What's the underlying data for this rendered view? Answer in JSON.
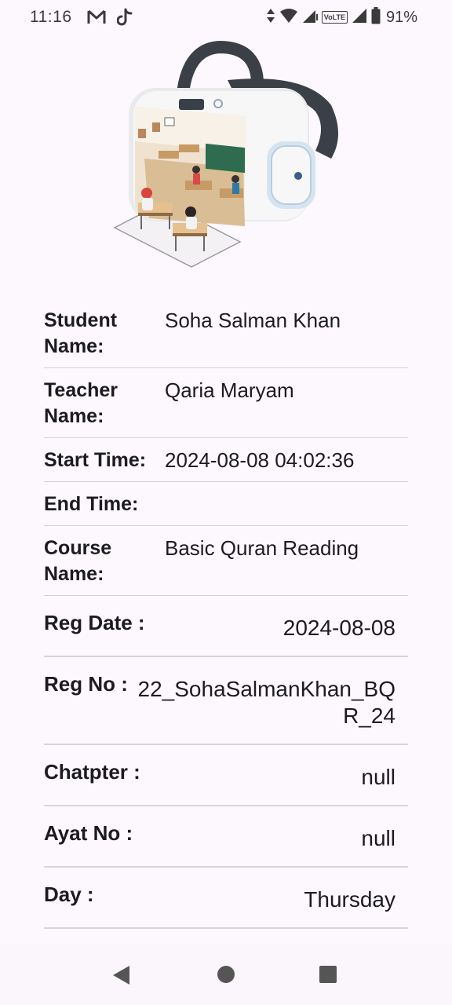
{
  "status_bar": {
    "time": "11:16",
    "battery_percent": "91%",
    "volte": "VoLTE"
  },
  "hero": {
    "icon": "vr-headset-classroom-illustration"
  },
  "details_a": [
    {
      "label": "Student Name:",
      "value": "Soha Salman Khan"
    },
    {
      "label": "Teacher Name:",
      "value": "Qaria Maryam"
    },
    {
      "label": "Start Time:",
      "value": "2024-08-08 04:02:36"
    },
    {
      "label": "End Time:",
      "value": ""
    },
    {
      "label": "Course Name:",
      "value": "Basic Quran Reading"
    }
  ],
  "details_b": [
    {
      "label": "Reg Date :",
      "value": "2024-08-08"
    },
    {
      "label": "Reg No :",
      "value": "22_SohaSalmanKhan_BQR_24"
    },
    {
      "label": "Chatpter :",
      "value": "null"
    },
    {
      "label": "Ayat No :",
      "value": "null"
    },
    {
      "label": "Day :",
      "value": "Thursday"
    }
  ],
  "colors": {
    "background": "#fdf8fd",
    "divider": "#d4d0d4",
    "text": "#1c1b1f"
  }
}
